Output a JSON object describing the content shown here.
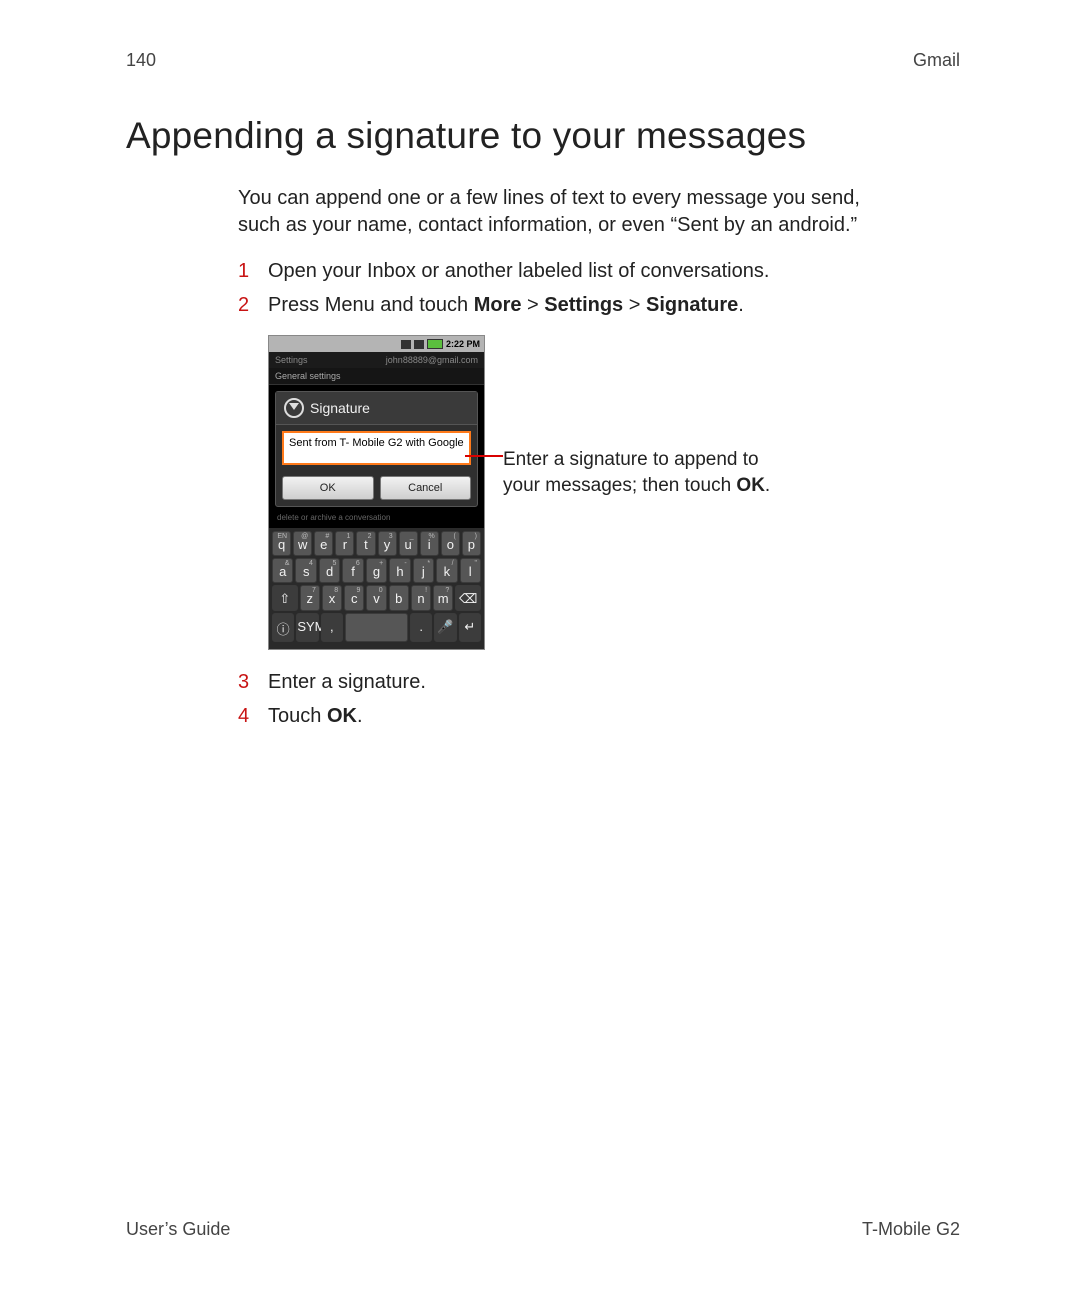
{
  "header": {
    "page_number": "140",
    "section": "Gmail"
  },
  "title": "Appending a signature to your messages",
  "intro": "You can append one or a few lines of text to every message you send, such as your name, contact information, or even “Sent by an android.”",
  "steps": {
    "s1": {
      "num": "1",
      "text": "Open your Inbox or another labeled list of conversations."
    },
    "s2": {
      "num": "2",
      "pre": "Press ",
      "menu": "Menu",
      "mid": " and touch ",
      "more": "More",
      "gt1": " > ",
      "settings": "Settings",
      "gt2": " > ",
      "signature": "Signature",
      "end": "."
    },
    "s3": {
      "num": "3",
      "text": "Enter a signature."
    },
    "s4": {
      "num": "4",
      "pre": "Touch ",
      "ok": "OK",
      "end": "."
    }
  },
  "annotation": {
    "line1": "Enter a signature to append to",
    "line2_pre": "your messages; then touch ",
    "ok": "OK",
    "end": "."
  },
  "phone": {
    "status_time": "2:22 PM",
    "appbar_left": "Settings",
    "appbar_right": "john88889@gmail.com",
    "section_label": "General settings",
    "dialog_title": "Signature",
    "signature_value": "Sent from T- Mobile G2 with Google",
    "ok_label": "OK",
    "cancel_label": "Cancel",
    "faint_row": "delete or archive a conversation",
    "keyboard": {
      "row1": [
        {
          "k": "q",
          "a": "EN"
        },
        {
          "k": "w",
          "a": "@"
        },
        {
          "k": "e",
          "a": "#"
        },
        {
          "k": "r",
          "a": "1"
        },
        {
          "k": "t",
          "a": "2"
        },
        {
          "k": "y",
          "a": "3"
        },
        {
          "k": "u",
          "a": "_"
        },
        {
          "k": "i",
          "a": "%"
        },
        {
          "k": "o",
          "a": "("
        },
        {
          "k": "p",
          "a": ")"
        }
      ],
      "row2": [
        {
          "k": "a",
          "a": "&"
        },
        {
          "k": "s",
          "a": "4"
        },
        {
          "k": "d",
          "a": "5"
        },
        {
          "k": "f",
          "a": "6"
        },
        {
          "k": "g",
          "a": "+"
        },
        {
          "k": "h",
          "a": "-"
        },
        {
          "k": "j",
          "a": "*"
        },
        {
          "k": "k",
          "a": "/"
        },
        {
          "k": "l",
          "a": "\""
        }
      ],
      "row3_main": [
        {
          "k": "z",
          "a": "7"
        },
        {
          "k": "x",
          "a": "8"
        },
        {
          "k": "c",
          "a": "9"
        },
        {
          "k": "v",
          "a": "0"
        },
        {
          "k": "b",
          "a": ""
        },
        {
          "k": "n",
          "a": "!"
        },
        {
          "k": "m",
          "a": "?"
        }
      ],
      "shift": "⇧",
      "backspace": "⌫",
      "sym": "SYM",
      "comma": ",",
      "period": ".",
      "mic": "⬇",
      "enter": "↵"
    }
  },
  "footer": {
    "left": "User’s Guide",
    "right": "T-Mobile G2"
  }
}
